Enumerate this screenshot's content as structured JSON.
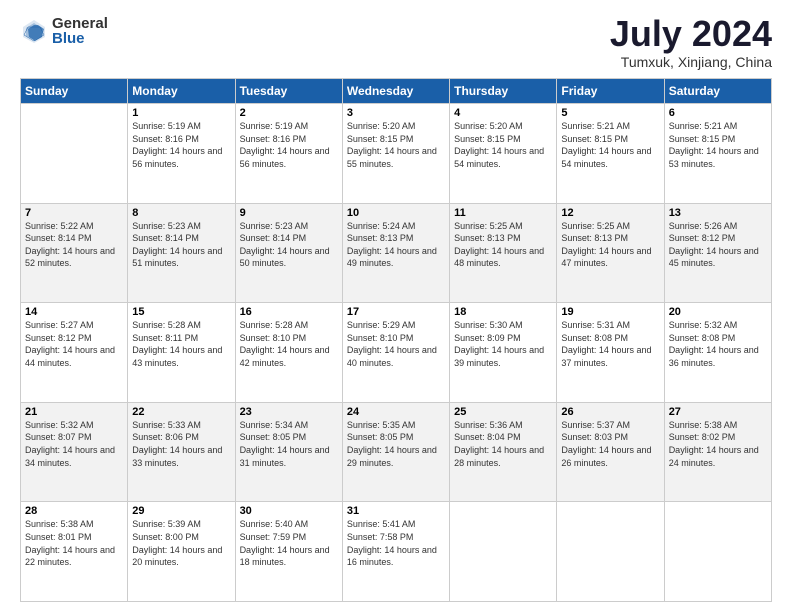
{
  "logo": {
    "general": "General",
    "blue": "Blue"
  },
  "title": "July 2024",
  "location": "Tumxuk, Xinjiang, China",
  "weekdays": [
    "Sunday",
    "Monday",
    "Tuesday",
    "Wednesday",
    "Thursday",
    "Friday",
    "Saturday"
  ],
  "weeks": [
    [
      {
        "day": "",
        "sunrise": "",
        "sunset": "",
        "daylight": ""
      },
      {
        "day": "1",
        "sunrise": "Sunrise: 5:19 AM",
        "sunset": "Sunset: 8:16 PM",
        "daylight": "Daylight: 14 hours and 56 minutes."
      },
      {
        "day": "2",
        "sunrise": "Sunrise: 5:19 AM",
        "sunset": "Sunset: 8:16 PM",
        "daylight": "Daylight: 14 hours and 56 minutes."
      },
      {
        "day": "3",
        "sunrise": "Sunrise: 5:20 AM",
        "sunset": "Sunset: 8:15 PM",
        "daylight": "Daylight: 14 hours and 55 minutes."
      },
      {
        "day": "4",
        "sunrise": "Sunrise: 5:20 AM",
        "sunset": "Sunset: 8:15 PM",
        "daylight": "Daylight: 14 hours and 54 minutes."
      },
      {
        "day": "5",
        "sunrise": "Sunrise: 5:21 AM",
        "sunset": "Sunset: 8:15 PM",
        "daylight": "Daylight: 14 hours and 54 minutes."
      },
      {
        "day": "6",
        "sunrise": "Sunrise: 5:21 AM",
        "sunset": "Sunset: 8:15 PM",
        "daylight": "Daylight: 14 hours and 53 minutes."
      }
    ],
    [
      {
        "day": "7",
        "sunrise": "Sunrise: 5:22 AM",
        "sunset": "Sunset: 8:14 PM",
        "daylight": "Daylight: 14 hours and 52 minutes."
      },
      {
        "day": "8",
        "sunrise": "Sunrise: 5:23 AM",
        "sunset": "Sunset: 8:14 PM",
        "daylight": "Daylight: 14 hours and 51 minutes."
      },
      {
        "day": "9",
        "sunrise": "Sunrise: 5:23 AM",
        "sunset": "Sunset: 8:14 PM",
        "daylight": "Daylight: 14 hours and 50 minutes."
      },
      {
        "day": "10",
        "sunrise": "Sunrise: 5:24 AM",
        "sunset": "Sunset: 8:13 PM",
        "daylight": "Daylight: 14 hours and 49 minutes."
      },
      {
        "day": "11",
        "sunrise": "Sunrise: 5:25 AM",
        "sunset": "Sunset: 8:13 PM",
        "daylight": "Daylight: 14 hours and 48 minutes."
      },
      {
        "day": "12",
        "sunrise": "Sunrise: 5:25 AM",
        "sunset": "Sunset: 8:13 PM",
        "daylight": "Daylight: 14 hours and 47 minutes."
      },
      {
        "day": "13",
        "sunrise": "Sunrise: 5:26 AM",
        "sunset": "Sunset: 8:12 PM",
        "daylight": "Daylight: 14 hours and 45 minutes."
      }
    ],
    [
      {
        "day": "14",
        "sunrise": "Sunrise: 5:27 AM",
        "sunset": "Sunset: 8:12 PM",
        "daylight": "Daylight: 14 hours and 44 minutes."
      },
      {
        "day": "15",
        "sunrise": "Sunrise: 5:28 AM",
        "sunset": "Sunset: 8:11 PM",
        "daylight": "Daylight: 14 hours and 43 minutes."
      },
      {
        "day": "16",
        "sunrise": "Sunrise: 5:28 AM",
        "sunset": "Sunset: 8:10 PM",
        "daylight": "Daylight: 14 hours and 42 minutes."
      },
      {
        "day": "17",
        "sunrise": "Sunrise: 5:29 AM",
        "sunset": "Sunset: 8:10 PM",
        "daylight": "Daylight: 14 hours and 40 minutes."
      },
      {
        "day": "18",
        "sunrise": "Sunrise: 5:30 AM",
        "sunset": "Sunset: 8:09 PM",
        "daylight": "Daylight: 14 hours and 39 minutes."
      },
      {
        "day": "19",
        "sunrise": "Sunrise: 5:31 AM",
        "sunset": "Sunset: 8:08 PM",
        "daylight": "Daylight: 14 hours and 37 minutes."
      },
      {
        "day": "20",
        "sunrise": "Sunrise: 5:32 AM",
        "sunset": "Sunset: 8:08 PM",
        "daylight": "Daylight: 14 hours and 36 minutes."
      }
    ],
    [
      {
        "day": "21",
        "sunrise": "Sunrise: 5:32 AM",
        "sunset": "Sunset: 8:07 PM",
        "daylight": "Daylight: 14 hours and 34 minutes."
      },
      {
        "day": "22",
        "sunrise": "Sunrise: 5:33 AM",
        "sunset": "Sunset: 8:06 PM",
        "daylight": "Daylight: 14 hours and 33 minutes."
      },
      {
        "day": "23",
        "sunrise": "Sunrise: 5:34 AM",
        "sunset": "Sunset: 8:05 PM",
        "daylight": "Daylight: 14 hours and 31 minutes."
      },
      {
        "day": "24",
        "sunrise": "Sunrise: 5:35 AM",
        "sunset": "Sunset: 8:05 PM",
        "daylight": "Daylight: 14 hours and 29 minutes."
      },
      {
        "day": "25",
        "sunrise": "Sunrise: 5:36 AM",
        "sunset": "Sunset: 8:04 PM",
        "daylight": "Daylight: 14 hours and 28 minutes."
      },
      {
        "day": "26",
        "sunrise": "Sunrise: 5:37 AM",
        "sunset": "Sunset: 8:03 PM",
        "daylight": "Daylight: 14 hours and 26 minutes."
      },
      {
        "day": "27",
        "sunrise": "Sunrise: 5:38 AM",
        "sunset": "Sunset: 8:02 PM",
        "daylight": "Daylight: 14 hours and 24 minutes."
      }
    ],
    [
      {
        "day": "28",
        "sunrise": "Sunrise: 5:38 AM",
        "sunset": "Sunset: 8:01 PM",
        "daylight": "Daylight: 14 hours and 22 minutes."
      },
      {
        "day": "29",
        "sunrise": "Sunrise: 5:39 AM",
        "sunset": "Sunset: 8:00 PM",
        "daylight": "Daylight: 14 hours and 20 minutes."
      },
      {
        "day": "30",
        "sunrise": "Sunrise: 5:40 AM",
        "sunset": "Sunset: 7:59 PM",
        "daylight": "Daylight: 14 hours and 18 minutes."
      },
      {
        "day": "31",
        "sunrise": "Sunrise: 5:41 AM",
        "sunset": "Sunset: 7:58 PM",
        "daylight": "Daylight: 14 hours and 16 minutes."
      },
      {
        "day": "",
        "sunrise": "",
        "sunset": "",
        "daylight": ""
      },
      {
        "day": "",
        "sunrise": "",
        "sunset": "",
        "daylight": ""
      },
      {
        "day": "",
        "sunrise": "",
        "sunset": "",
        "daylight": ""
      }
    ]
  ]
}
